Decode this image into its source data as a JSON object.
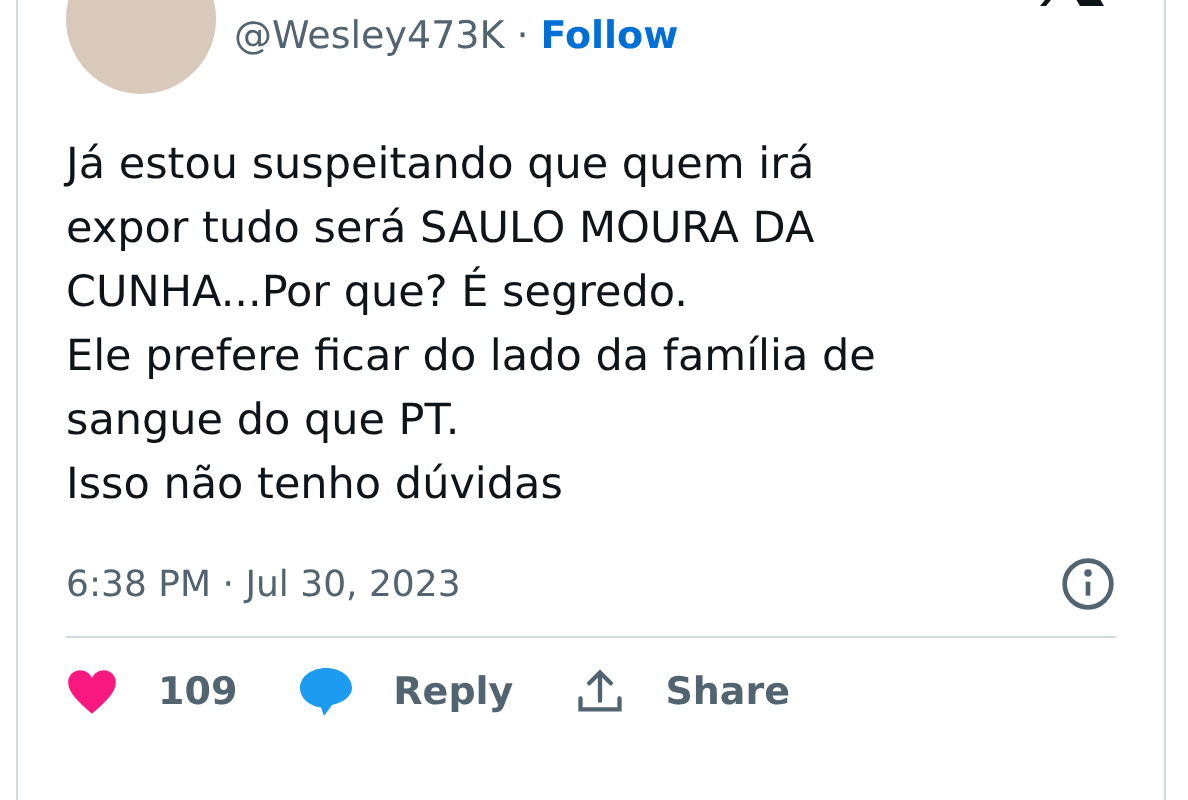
{
  "author": {
    "handle": "@Wesley473K",
    "separator": "·",
    "follow": "Follow"
  },
  "tweet": {
    "lines": [
      "Já estou suspeitando que quem irá",
      "expor tudo será SAULO MOURA DA",
      "CUNHA...Por que? É segredo.",
      "Ele prefere ficar do lado da família de",
      "sangue do que PT.",
      "Isso não tenho dúvidas"
    ],
    "timestamp": "6:38 PM · Jul 30, 2023"
  },
  "actions": [
    {
      "kind": "like",
      "label": "109"
    },
    {
      "kind": "reply",
      "label": "Reply"
    },
    {
      "kind": "share",
      "label": "Share"
    }
  ]
}
